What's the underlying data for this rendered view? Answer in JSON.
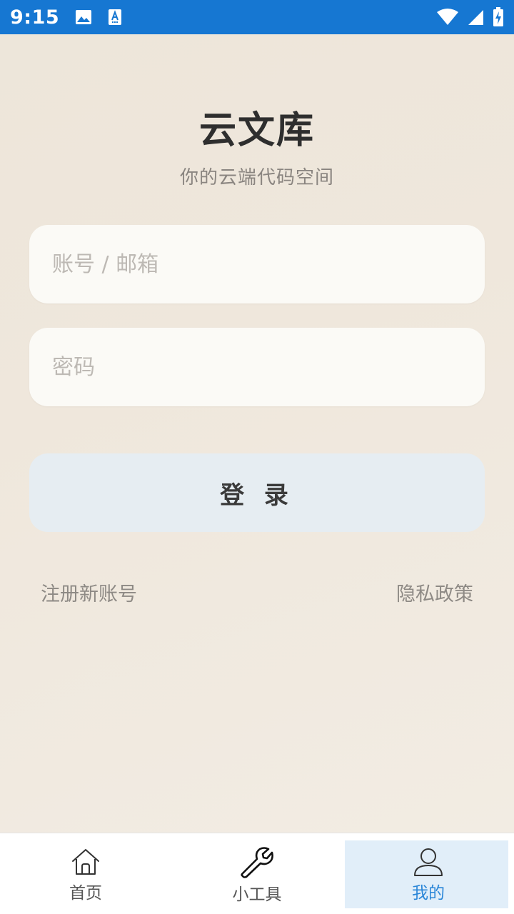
{
  "status_bar": {
    "time": "9:15",
    "left_icons": [
      "image-icon",
      "text-a-icon"
    ],
    "right_icons": [
      "wifi-icon",
      "signal-icon",
      "battery-charging-icon"
    ],
    "background": "#1677d2"
  },
  "header": {
    "title": "云文库",
    "subtitle": "你的云端代码空间"
  },
  "form": {
    "username_placeholder": "账号 / 邮箱",
    "username_value": "",
    "password_placeholder": "密码",
    "password_value": "",
    "login_label": "登 录"
  },
  "links": {
    "register": "注册新账号",
    "privacy": "隐私政策"
  },
  "bottom_nav": {
    "items": [
      {
        "label": "首页",
        "icon": "home-icon",
        "active": false
      },
      {
        "label": "小工具",
        "icon": "wrench-icon",
        "active": false
      },
      {
        "label": "我的",
        "icon": "person-icon",
        "active": true
      }
    ],
    "active_color": "#2a86d8"
  }
}
